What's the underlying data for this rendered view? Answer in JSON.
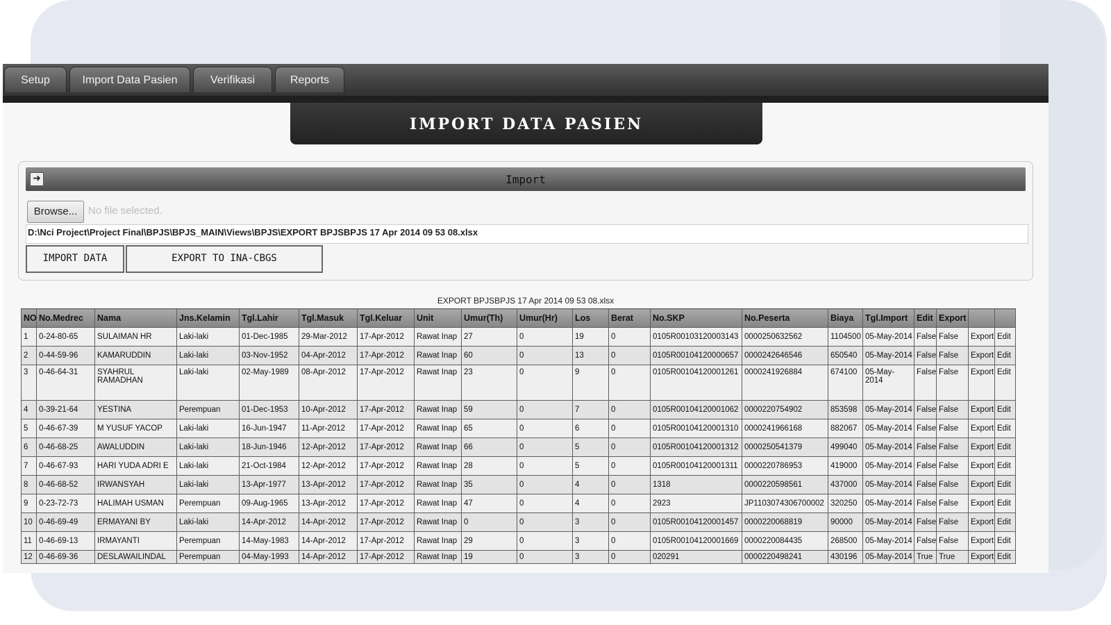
{
  "menu": {
    "tabs": [
      {
        "label": "Setup"
      },
      {
        "label": "Import Data Pasien"
      },
      {
        "label": "Verifikasi"
      },
      {
        "label": "Reports"
      }
    ]
  },
  "page_title": "IMPORT DATA PASIEN",
  "import_panel": {
    "header": "Import",
    "browse_label": "Browse...",
    "no_file_text": "No file selected.",
    "file_path": "D:\\Nci Project\\Project Final\\BPJS\\BPJS_MAIN\\Views\\BPJS\\EXPORT BPJSBPJS 17 Apr 2014 09 53 08.xlsx",
    "import_button": "IMPORT DATA",
    "export_button": "EXPORT TO INA-CBGS"
  },
  "file_caption": "EXPORT BPJSBPJS 17 Apr 2014 09 53 08.xlsx",
  "table": {
    "headers": [
      "NO",
      "No.Medrec",
      "Nama",
      "Jns.Kelamin",
      "Tgl.Lahir",
      "Tgl.Masuk",
      "Tgl.Keluar",
      "Unit",
      "Umur(Th)",
      "Umur(Hr)",
      "Los",
      "Berat",
      "No.SKP",
      "No.Peserta",
      "Biaya",
      "Tgl.Import",
      "Edit",
      "Export",
      "",
      ""
    ],
    "rows": [
      [
        "1",
        "0-24-80-65",
        "SULAIMAN HR",
        "Laki-laki",
        "01-Dec-1985",
        "29-Mar-2012",
        "17-Apr-2012",
        "Rawat Inap",
        "27",
        "0",
        "19",
        "0",
        "0105R00103120003143",
        "0000250632562",
        "1104500",
        "05-May-2014",
        "False",
        "False",
        "Export",
        "Edit"
      ],
      [
        "2",
        "0-44-59-96",
        "KAMARUDDIN",
        "Laki-laki",
        "03-Nov-1952",
        "04-Apr-2012",
        "17-Apr-2012",
        "Rawat Inap",
        "60",
        "0",
        "13",
        "0",
        "0105R00104120000657",
        "0000242646546",
        "650540",
        "05-May-2014",
        "False",
        "False",
        "Export",
        "Edit"
      ],
      [
        "3",
        "0-46-64-31",
        "SYAHRUL RAMADHAN",
        "Laki-laki",
        "02-May-1989",
        "08-Apr-2012",
        "17-Apr-2012",
        "Rawat Inap",
        "23",
        "0",
        "9",
        "0",
        "0105R00104120001261",
        "0000241926884",
        "674100",
        "05-May-2014",
        "False",
        "False",
        "Export",
        "Edit"
      ],
      [
        "4",
        "0-39-21-64",
        "YESTINA",
        "Perempuan",
        "01-Dec-1953",
        "10-Apr-2012",
        "17-Apr-2012",
        "Rawat Inap",
        "59",
        "0",
        "7",
        "0",
        "0105R00104120001062",
        "0000220754902",
        "853598",
        "05-May-2014",
        "False",
        "False",
        "Export",
        "Edit"
      ],
      [
        "5",
        "0-46-67-39",
        "M YUSUF YACOP",
        "Laki-laki",
        "16-Jun-1947",
        "11-Apr-2012",
        "17-Apr-2012",
        "Rawat Inap",
        "65",
        "0",
        "6",
        "0",
        "0105R00104120001310",
        "0000241966168",
        "882067",
        "05-May-2014",
        "False",
        "False",
        "Export",
        "Edit"
      ],
      [
        "6",
        "0-46-68-25",
        "AWALUDDIN",
        "Laki-laki",
        "18-Jun-1946",
        "12-Apr-2012",
        "17-Apr-2012",
        "Rawat Inap",
        "66",
        "0",
        "5",
        "0",
        "0105R00104120001312",
        "0000250541379",
        "499040",
        "05-May-2014",
        "False",
        "False",
        "Export",
        "Edit"
      ],
      [
        "7",
        "0-46-67-93",
        "HARI YUDA ADRI E",
        "Laki-laki",
        "21-Oct-1984",
        "12-Apr-2012",
        "17-Apr-2012",
        "Rawat Inap",
        "28",
        "0",
        "5",
        "0",
        "0105R00104120001311",
        "0000220786953",
        "419000",
        "05-May-2014",
        "False",
        "False",
        "Export",
        "Edit"
      ],
      [
        "8",
        "0-46-68-52",
        "IRWANSYAH",
        "Laki-laki",
        "13-Apr-1977",
        "13-Apr-2012",
        "17-Apr-2012",
        "Rawat Inap",
        "35",
        "0",
        "4",
        "0",
        "1318",
        "0000220598561",
        "437000",
        "05-May-2014",
        "False",
        "False",
        "Export",
        "Edit"
      ],
      [
        "9",
        "0-23-72-73",
        "HALIMAH USMAN",
        "Perempuan",
        "09-Aug-1965",
        "13-Apr-2012",
        "17-Apr-2012",
        "Rawat Inap",
        "47",
        "0",
        "4",
        "0",
        "2923",
        "JP1103074306700002",
        "320250",
        "05-May-2014",
        "False",
        "False",
        "Export",
        "Edit"
      ],
      [
        "10",
        "0-46-69-49",
        "ERMAYANI BY",
        "Laki-laki",
        "14-Apr-2012",
        "14-Apr-2012",
        "17-Apr-2012",
        "Rawat Inap",
        "0",
        "0",
        "3",
        "0",
        "0105R00104120001457",
        "0000220068819",
        "90000",
        "05-May-2014",
        "False",
        "False",
        "Export",
        "Edit"
      ],
      [
        "11",
        "0-46-69-13",
        "IRMAYANTI",
        "Perempuan",
        "14-May-1983",
        "14-Apr-2012",
        "17-Apr-2012",
        "Rawat Inap",
        "29",
        "0",
        "3",
        "0",
        "0105R00104120001669",
        "0000220084435",
        "268500",
        "05-May-2014",
        "False",
        "False",
        "Export",
        "Edit"
      ],
      [
        "12",
        "0-46-69-36",
        "DESLAWAILINDAL",
        "Perempuan",
        "04-May-1993",
        "14-Apr-2012",
        "17-Apr-2012",
        "Rawat Inap",
        "19",
        "0",
        "3",
        "0",
        "020291",
        "0000220498241",
        "430196",
        "05-May-2014",
        "True",
        "True",
        "Export",
        "Edit"
      ]
    ]
  }
}
